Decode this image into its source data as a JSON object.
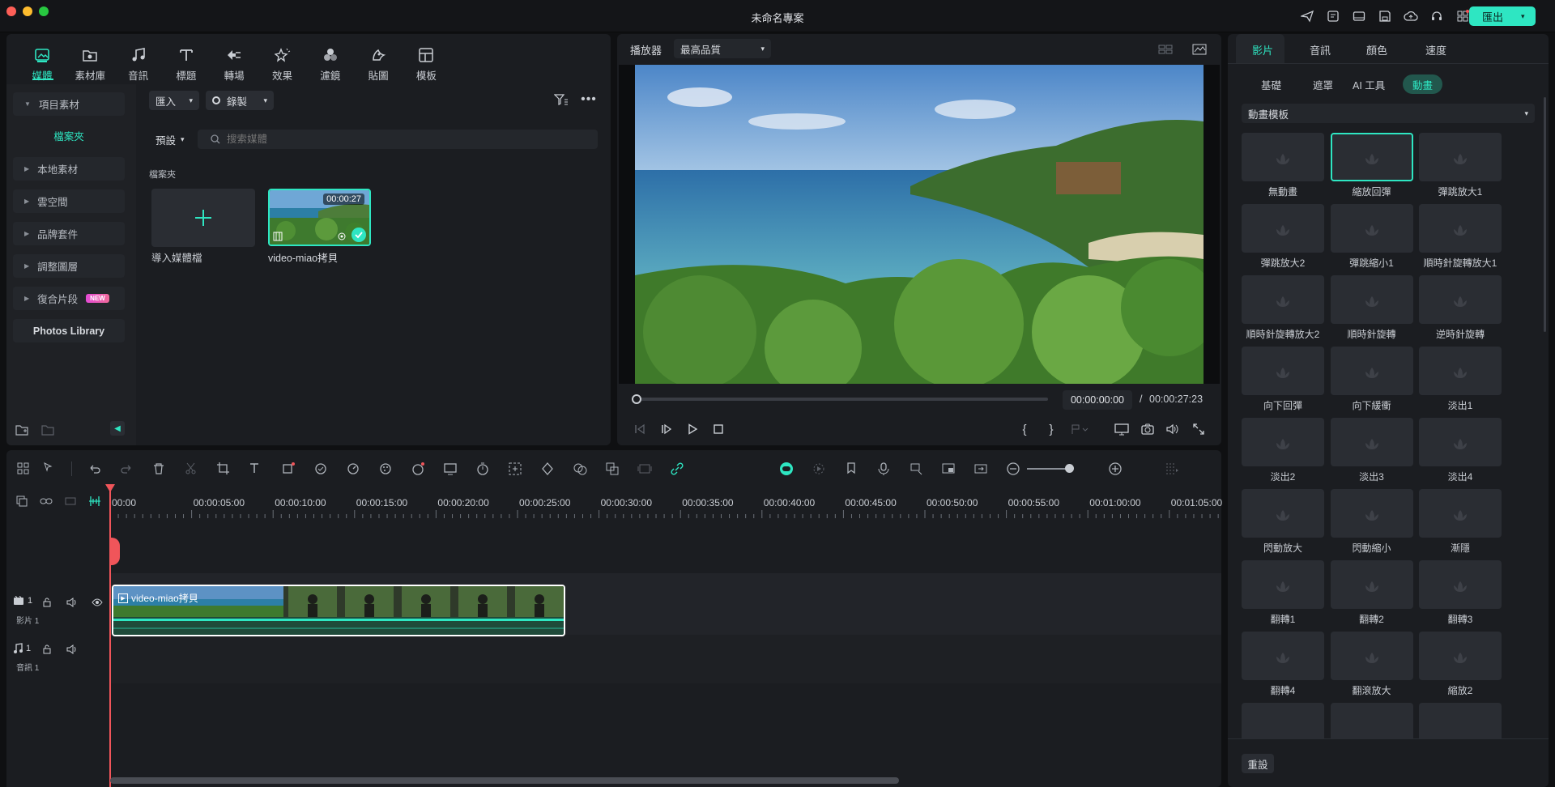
{
  "app": {
    "title": "未命名專案"
  },
  "topbar": {
    "export_label": "匯出"
  },
  "media_panel": {
    "tabs": [
      {
        "label": "媒體",
        "icon": "media-icon"
      },
      {
        "label": "素材庫",
        "icon": "stock-icon"
      },
      {
        "label": "音訊",
        "icon": "audio-icon"
      },
      {
        "label": "標題",
        "icon": "title-icon"
      },
      {
        "label": "轉場",
        "icon": "transition-icon"
      },
      {
        "label": "效果",
        "icon": "effects-icon"
      },
      {
        "label": "濾鏡",
        "icon": "filters-icon"
      },
      {
        "label": "貼圖",
        "icon": "stickers-icon"
      },
      {
        "label": "模板",
        "icon": "templates-icon"
      }
    ],
    "sidebar": {
      "project_media": "項目素材",
      "folder": "檔案夾",
      "items": [
        "本地素材",
        "雲空間",
        "品牌套件",
        "調整圖層",
        "復合片段"
      ],
      "new_badge": "NEW",
      "photos_library": "Photos Library"
    },
    "import_label": "匯入",
    "record_label": "錄製",
    "preset_label": "預設",
    "search_placeholder": "搜索媒體",
    "folder_heading": "檔案夾",
    "import_card_label": "導入媒體檔",
    "clip": {
      "name": "video-miao拷貝",
      "duration": "00:00:27"
    }
  },
  "player": {
    "label": "播放器",
    "quality": "最高品質",
    "current_time": "00:00:00:00",
    "separator": "/",
    "total_time": "00:00:27:23",
    "progress": 0
  },
  "right_panel": {
    "tabs": [
      "影片",
      "音訊",
      "顏色",
      "速度"
    ],
    "subtabs": [
      "基礎",
      "遮罩",
      "AI 工具",
      "動畫"
    ],
    "dropdown_label": "動畫模板",
    "animations": [
      "無動畫",
      "縮放回彈",
      "彈跳放大1",
      "彈跳放大2",
      "彈跳縮小1",
      "順時針旋轉放大1",
      "順時針旋轉放大2",
      "順時針旋轉",
      "逆時針旋轉",
      "向下回彈",
      "向下緩衝",
      "淡出1",
      "淡出2",
      "淡出3",
      "淡出4",
      "閃動放大",
      "閃動縮小",
      "漸隱",
      "翻轉1",
      "翻轉2",
      "翻轉3",
      "翻轉4",
      "翻滾放大",
      "縮放2"
    ],
    "selected_animation": "縮放回彈",
    "reset_label": "重設"
  },
  "timeline": {
    "ruler": [
      "00:00",
      "00:00:05:00",
      "00:00:10:00",
      "00:00:15:00",
      "00:00:20:00",
      "00:00:25:00",
      "00:00:30:00",
      "00:00:35:00",
      "00:00:40:00",
      "00:00:45:00",
      "00:00:50:00",
      "00:00:55:00",
      "00:01:00:00",
      "00:01:05:00"
    ],
    "video_track": {
      "number": "1",
      "label": "影片 1"
    },
    "audio_track": {
      "number": "1",
      "label": "音訊 1"
    },
    "clip_name": "video-miao拷貝"
  },
  "colors": {
    "accent": "#2ee6c2",
    "playhead": "#f0555a",
    "new_badge": "#e44bd6"
  }
}
